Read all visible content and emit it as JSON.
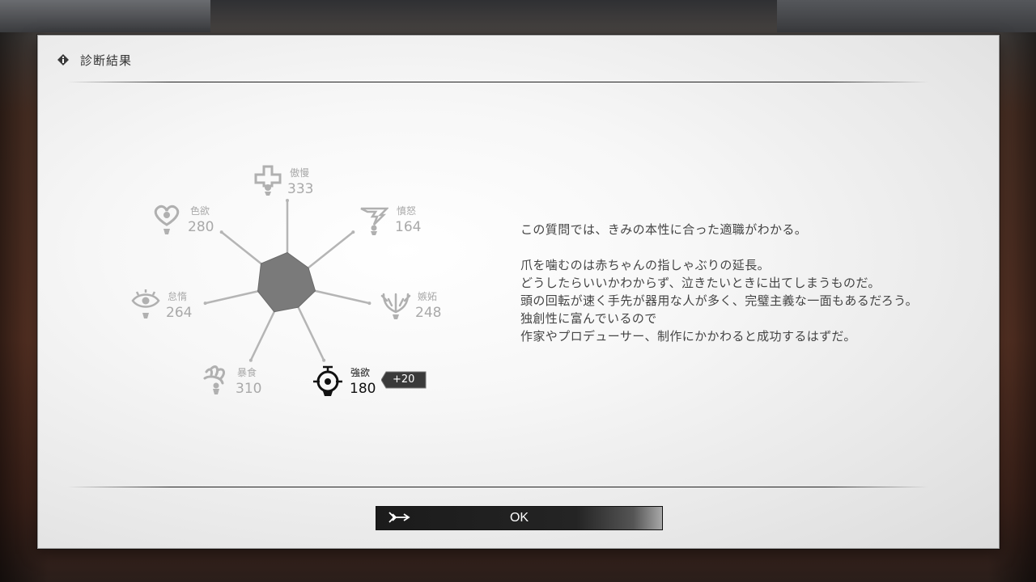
{
  "dialog": {
    "title": "診断結果",
    "title_icon": "info-diamond-icon"
  },
  "traits": [
    {
      "key": "pride",
      "label": "傲慢",
      "value": "333",
      "icon": "cross-icon",
      "active": false
    },
    {
      "key": "wrath",
      "label": "憤怒",
      "value": "164",
      "icon": "lightning-icon",
      "active": false
    },
    {
      "key": "envy",
      "label": "嫉妬",
      "value": "248",
      "icon": "antler-icon",
      "active": false
    },
    {
      "key": "greed",
      "label": "強欲",
      "value": "180",
      "icon": "coin-target-icon",
      "active": true,
      "delta": "+20"
    },
    {
      "key": "gluttony",
      "label": "暴食",
      "value": "310",
      "icon": "claw-icon",
      "active": false
    },
    {
      "key": "sloth",
      "label": "怠惰",
      "value": "264",
      "icon": "eye-icon",
      "active": false
    },
    {
      "key": "lust",
      "label": "色欲",
      "value": "280",
      "icon": "heart-icon",
      "active": false
    }
  ],
  "radar_levels": [
    0.38,
    0.32,
    0.34,
    0.3,
    0.36,
    0.36,
    0.4
  ],
  "colors": {
    "radar_fill": "#7a7a7a",
    "spoke": "#b5b5b5",
    "inactive_text": "#a9a9a9",
    "active_text": "#111111"
  },
  "message": {
    "line1": "この質問では、きみの本性に合った適職がわかる。",
    "line2": "爪を噛むのは赤ちゃんの指しゃぶりの延長。",
    "line3": "どうしたらいいかわからず、泣きたいときに出てしまうものだ。",
    "line4": "頭の回転が速く手先が器用な人が多く、完璧主義な一面もあるだろう。",
    "line5": "独創性に富んでいるので",
    "line6": "作家やプロデューサー、制作にかかわると成功するはずだ。"
  },
  "ok_button": {
    "label": "OK",
    "icon": "arrow-emblem-icon"
  }
}
